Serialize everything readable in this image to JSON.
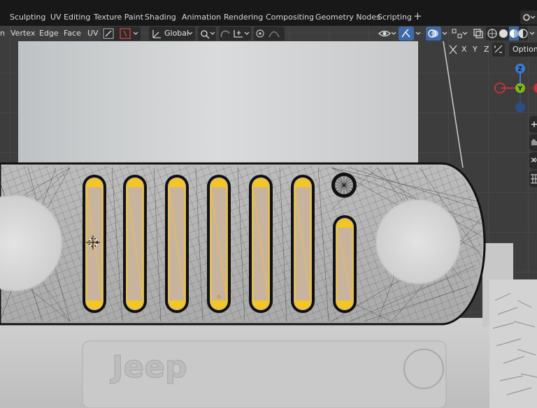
{
  "workspace_tabs": [
    {
      "label": "Sculpting"
    },
    {
      "label": "UV Editing"
    },
    {
      "label": "Texture Paint"
    },
    {
      "label": "Shading"
    },
    {
      "label": "Animation"
    },
    {
      "label": "Rendering"
    },
    {
      "label": "Compositing"
    },
    {
      "label": "Geometry Nodes"
    },
    {
      "label": "Scripting"
    }
  ],
  "add_workspace_glyph": "+",
  "viewport_header": {
    "menus": [
      {
        "label": "n"
      },
      {
        "label": "Vertex"
      },
      {
        "label": "Edge"
      },
      {
        "label": "Face"
      },
      {
        "label": "UV"
      }
    ],
    "transform_orientation": "Global",
    "options_label": "Options",
    "axes": [
      "X",
      "Y",
      "Z"
    ]
  },
  "gizmo": {
    "x_label": "X",
    "y_label": "Y",
    "z_label": "Z",
    "colors": {
      "x": "#c8323c",
      "y": "#7fb81e",
      "z": "#3a7bd5"
    }
  },
  "icons": [
    "chevron-down-icon",
    "global-orientation-icon",
    "pivot-icon",
    "snap-icon",
    "proportional-edit-icon",
    "falloff-icon",
    "visibility-icon",
    "gizmo-toggle-icon",
    "overlay-icon",
    "xray-icon",
    "wireframe-shading-icon",
    "solid-shading-icon",
    "material-shading-icon",
    "rendered-shading-icon",
    "zoom-icon",
    "hand-pan-icon",
    "camera-icon",
    "grid-icon",
    "mirror-icon"
  ],
  "colors": {
    "accent": "#3f6aa8",
    "selection": "#ffd23a",
    "background": "#3d3d3d"
  }
}
